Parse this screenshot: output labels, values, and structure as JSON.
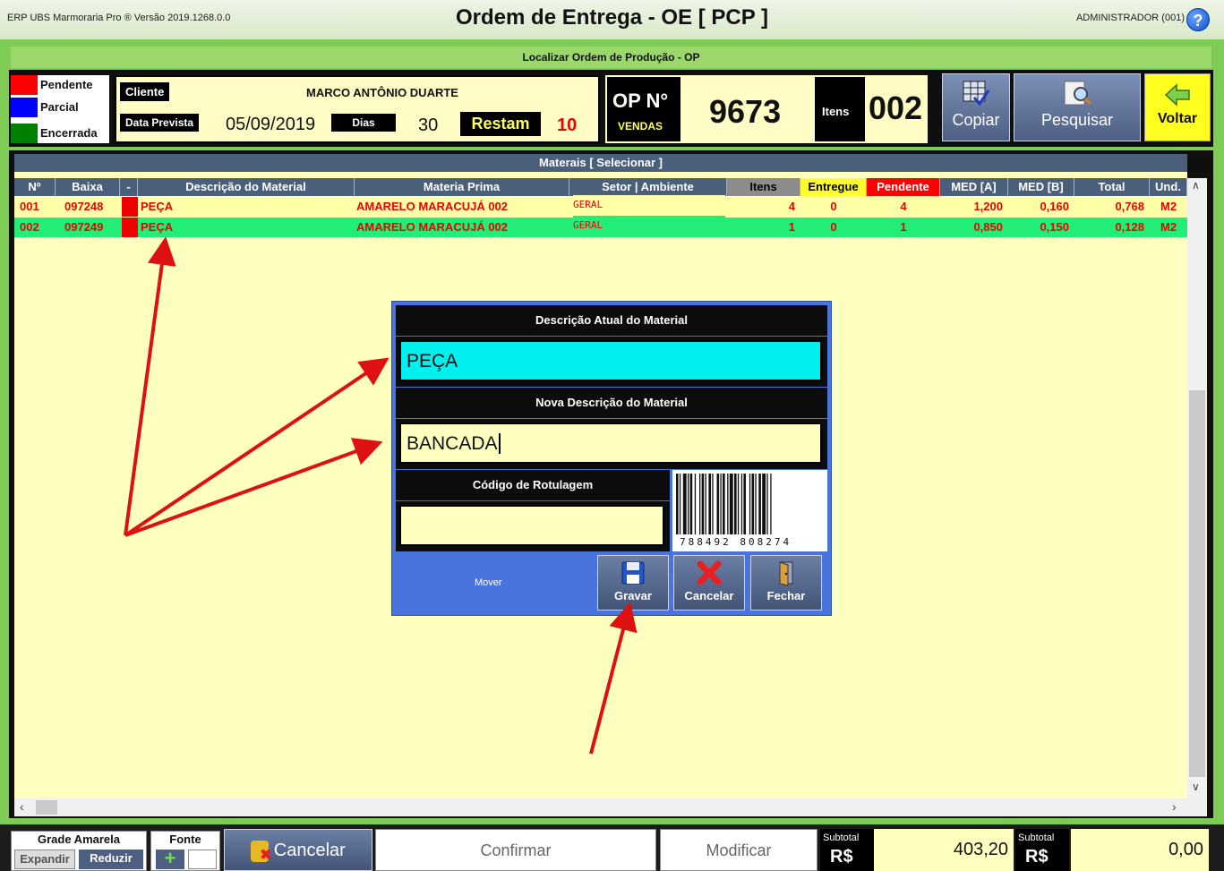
{
  "app_version": "ERP UBS Marmoraria Pro ® Versão 2019.1268.0.0",
  "window_title": "Ordem de Entrega - OE [ PCP ]",
  "user": "ADMINISTRADOR (001)",
  "search_title": "Localizar Ordem de Produção - OP",
  "legend": [
    {
      "label": "Pendente",
      "color": "#ff0000"
    },
    {
      "label": "Parcial",
      "color": "#0000ff"
    },
    {
      "label": "Encerrada",
      "color": "#008000"
    }
  ],
  "client": {
    "label": "Cliente",
    "name": "MARCO ANTÔNIO DUARTE",
    "date_label": "Data Prevista",
    "date": "05/09/2019",
    "days_label": "Dias",
    "days": "30",
    "remaining_label": "Restam",
    "remaining": "10"
  },
  "op": {
    "label": "OP N°",
    "sub": "VENDAS",
    "number": "9673",
    "items_label": "Itens",
    "items": "002"
  },
  "toolbar": {
    "copy": "Copiar",
    "search": "Pesquisar",
    "back": "Voltar"
  },
  "grid": {
    "title": "Materais [ Selecionar ]",
    "headers": [
      "Nº",
      "Baixa",
      "-",
      "Descrição do Material",
      "Materia Prima",
      "Setor | Ambiente",
      "Itens",
      "Entregue",
      "Pendente",
      "MED [A]",
      "MED [B]",
      "Total",
      "Und."
    ],
    "rows": [
      [
        "001",
        "097248",
        "",
        "PEÇA",
        "AMARELO MARACUJÁ 002",
        "GERAL",
        "4",
        "0",
        "4",
        "1,200",
        "0,160",
        "0,768",
        "M2"
      ],
      [
        "002",
        "097249",
        "",
        "PEÇA",
        "AMARELO MARACUJÁ 002",
        "GERAL",
        "1",
        "0",
        "1",
        "0,850",
        "0,150",
        "0,128",
        "M2"
      ]
    ]
  },
  "dialog": {
    "current_label": "Descrição Atual do Material",
    "current_value": "PEÇA",
    "new_label": "Nova Descrição do Material",
    "new_value": "BANCADA",
    "code_label": "Código de Rotulagem",
    "code_value": "",
    "barcode_digits": "788492 808274",
    "move": "Mover",
    "save": "Gravar",
    "cancel": "Cancelar",
    "close": "Fechar"
  },
  "footer": {
    "grid_label": "Grade Amarela",
    "expand": "Expandir",
    "reduce": "Reduzir",
    "font_label": "Fonte",
    "cancel": "Cancelar",
    "confirm": "Confirmar",
    "modify": "Modificar",
    "subtotal_label": "Subtotal",
    "currency": "R$",
    "subtotal1": "403,20",
    "subtotal2": "0,00"
  }
}
